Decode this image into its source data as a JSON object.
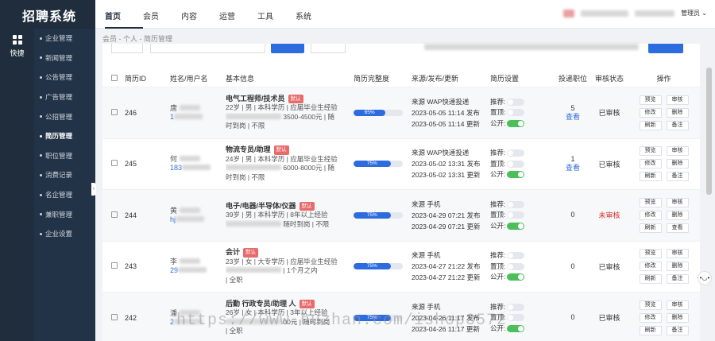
{
  "app": {
    "title": "招聘系统"
  },
  "rail": {
    "label": "快捷"
  },
  "menu": {
    "items": [
      {
        "label": "企业管理",
        "active": false
      },
      {
        "label": "新闻管理",
        "active": false
      },
      {
        "label": "公告管理",
        "active": false
      },
      {
        "label": "广告管理",
        "active": false
      },
      {
        "label": "公招管理",
        "active": false
      },
      {
        "label": "简历管理",
        "active": true
      },
      {
        "label": "职位管理",
        "active": false
      },
      {
        "label": "消费记录",
        "active": false
      },
      {
        "label": "名企管理",
        "active": false
      },
      {
        "label": "兼职管理",
        "active": false
      },
      {
        "label": "企业设置",
        "active": false
      }
    ]
  },
  "nav": {
    "items": [
      {
        "label": "首页",
        "active": true
      },
      {
        "label": "会员",
        "active": false
      },
      {
        "label": "内容",
        "active": false
      },
      {
        "label": "运营",
        "active": false
      },
      {
        "label": "工具",
        "active": false
      },
      {
        "label": "系统",
        "active": false
      }
    ]
  },
  "header": {
    "admin_label": "管理员 ⌄"
  },
  "breadcrumb": {
    "text": "会员 - 个人 - 简历管理"
  },
  "table": {
    "headers": {
      "id": "简历ID",
      "name": "姓名/用户名",
      "info": "基本信息",
      "progress": "简历完整度",
      "source": "来源/发布/更新",
      "settings": "简历设置",
      "positions": "投递职位",
      "audit": "审核状态",
      "ops": "操作"
    },
    "rows": [
      {
        "id": "246",
        "name": "唐",
        "user": "1",
        "title": "电气工程师/技术员",
        "tag": "默认",
        "line1": "22岁 | 男 | 本科学历 | 应届毕业生经验",
        "line2": "3500-4500元 | 随",
        "line3": "时到岗 | 不限",
        "progress": 65,
        "progress_label": "65%",
        "src": "来源 WAP快速投递",
        "pub": "2023-05-05 11:14 发布",
        "upd": "2023-05-05 11:14 更新",
        "rec": "推荐:",
        "top": "置顶:",
        "pub_label": "公开:",
        "rec_on": false,
        "top_on": false,
        "public_on": true,
        "positions": "5",
        "view": "查看",
        "audit": "已审核",
        "audited": true,
        "ops": [
          "预览",
          "审核",
          "修改",
          "删除",
          "刷新",
          "备注"
        ]
      },
      {
        "id": "245",
        "name": "何",
        "user": "183",
        "title": "物流专员/助理",
        "tag": "默认",
        "line1": "24岁 | 男 | 本科学历 | 应届毕业生经验",
        "line2": "6000-8000元 | 随",
        "line3": "时到岗 | 不限",
        "progress": 75,
        "progress_label": "75%",
        "src": "来源 WAP快速投递",
        "pub": "2023-05-02 13:31 发布",
        "upd": "2023-05-02 13:31 更新",
        "rec": "推荐:",
        "top": "置顶:",
        "pub_label": "公开:",
        "rec_on": false,
        "top_on": false,
        "public_on": true,
        "positions": "1",
        "view": "查看",
        "audit": "已审核",
        "audited": true,
        "ops": [
          "预览",
          "审核",
          "修改",
          "删除",
          "刷新",
          "备注"
        ]
      },
      {
        "id": "244",
        "name": "黄",
        "user": "hj",
        "title": "电子/电器/半导体/仪器",
        "tag": "默认",
        "line1": "39岁 | 男 | 本科学历 | 8年以上经验",
        "line2": "随时到岗 | 不限",
        "line3": "",
        "progress": 75,
        "progress_label": "75%",
        "src": "来源 手机",
        "pub": "2023-04-29 07:21 发布",
        "upd": "2023-04-29 07:21 更新",
        "rec": "推荐:",
        "top": "置顶:",
        "pub_label": "公开:",
        "rec_on": false,
        "top_on": false,
        "public_on": true,
        "positions": "0",
        "view": "",
        "audit": "未审核",
        "audited": false,
        "ops": [
          "预览",
          "审核",
          "修改",
          "删除",
          "刷新",
          "查看"
        ]
      },
      {
        "id": "243",
        "name": "李",
        "user": "29",
        "title": "会计",
        "tag": "默认",
        "line1": "23岁 | 女 | 大专学历 | 应届毕业生经验",
        "line2": "| 1个月之内",
        "line3": "| 全职",
        "progress": 75,
        "progress_label": "75%",
        "src": "来源 手机",
        "pub": "2023-04-27 21:22 发布",
        "upd": "2023-04-27 21:22 更新",
        "rec": "推荐:",
        "top": "置顶:",
        "pub_label": "公开:",
        "rec_on": false,
        "top_on": false,
        "public_on": true,
        "positions": "0",
        "view": "",
        "audit": "已审核",
        "audited": true,
        "ops": [
          "预览",
          "审核",
          "修改",
          "删除",
          "刷新",
          "备注"
        ]
      },
      {
        "id": "242",
        "name": "潘",
        "user": "2",
        "title": "后勤 行政专员/助理 人",
        "tag": "默认",
        "line1": "26岁 | 女 | 本科学历 | 3年以上经验",
        "line2": "00元 | 随时到岗",
        "line3": "| 全职",
        "progress": 75,
        "progress_label": "75%",
        "src": "来源 手机",
        "pub": "2023-04-26 11:17 发布",
        "upd": "2023-04-26 11:17 更新",
        "rec": "推荐:",
        "top": "置顶:",
        "pub_label": "公开:",
        "rec_on": false,
        "top_on": false,
        "public_on": true,
        "positions": "0",
        "view": "",
        "audit": "已审核",
        "audited": true,
        "ops": [
          "预览",
          "审核",
          "修改",
          "删除",
          "刷新",
          "备注"
        ]
      }
    ]
  },
  "watermark": "https://www.huzhan.com/ishop3572",
  "colors": {
    "sidebar": "#1f2d3d",
    "accent": "#2d6cdf",
    "switch_on": "#4cbf5a",
    "tag": "#e86a6a",
    "unaudited": "#d9302c"
  }
}
